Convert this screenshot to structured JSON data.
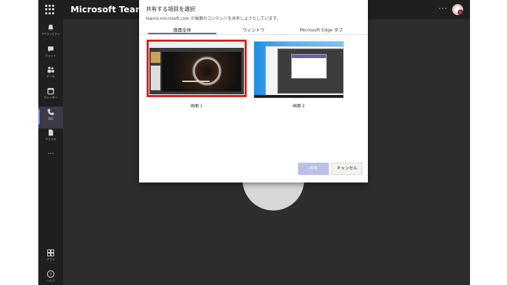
{
  "titlebar": {
    "app_title": "Microsoft Teams",
    "more_label": "···"
  },
  "rail": {
    "items": [
      {
        "icon": "bell-icon",
        "label": "アクティビティ"
      },
      {
        "icon": "chat-icon",
        "label": "チャット"
      },
      {
        "icon": "teams-icon",
        "label": "チーム"
      },
      {
        "icon": "calendar-icon",
        "label": "カレンダー"
      },
      {
        "icon": "phone-icon",
        "label": "通話"
      },
      {
        "icon": "file-icon",
        "label": "ファイル"
      }
    ],
    "more_label": "···",
    "bottom": [
      {
        "icon": "apps-icon",
        "label": "アプリ"
      },
      {
        "icon": "help-icon",
        "label": "ヘルプ"
      }
    ]
  },
  "dialog": {
    "title": "共有する項目を選択",
    "description": "teams.microsoft.com が画面のコンテンツを共有しようとしています。",
    "tabs": [
      {
        "label": "画面全体",
        "active": true
      },
      {
        "label": "ウィンドウ",
        "active": false
      },
      {
        "label": "Microsoft Edge タブ",
        "active": false
      }
    ],
    "screens": [
      {
        "label": "画面 1",
        "selected": true
      },
      {
        "label": "画面 2",
        "selected": false
      }
    ],
    "share_label": "共有",
    "cancel_label": "キャンセル"
  },
  "colors": {
    "accent": "#6264a7",
    "selection": "#e01b1b",
    "app_bg": "#292929"
  }
}
